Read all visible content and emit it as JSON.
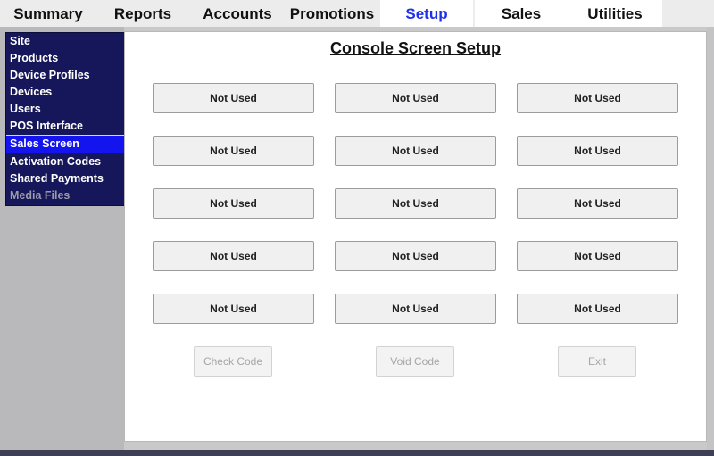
{
  "top_menu": [
    {
      "label": "Summary"
    },
    {
      "label": "Reports"
    },
    {
      "label": "Accounts"
    },
    {
      "label": "Promotions"
    },
    {
      "label": "Setup"
    },
    {
      "label": "Sales"
    },
    {
      "label": "Utilities"
    }
  ],
  "top_menu_active": "Setup",
  "sidebar": {
    "items": [
      {
        "label": "Site"
      },
      {
        "label": "Products"
      },
      {
        "label": "Device Profiles"
      },
      {
        "label": "Devices"
      },
      {
        "label": "Users"
      },
      {
        "label": "POS Interface"
      },
      {
        "label": "Sales Screen"
      },
      {
        "label": "Activation Codes"
      },
      {
        "label": "Shared Payments"
      },
      {
        "label": "Media Files"
      }
    ],
    "selected": "Sales Screen",
    "disabled": "Media Files"
  },
  "main": {
    "title": "Console Screen Setup",
    "slots": [
      [
        "Not Used",
        "Not Used",
        "Not Used"
      ],
      [
        "Not Used",
        "Not Used",
        "Not Used"
      ],
      [
        "Not Used",
        "Not Used",
        "Not Used"
      ],
      [
        "Not Used",
        "Not Used",
        "Not Used"
      ],
      [
        "Not Used",
        "Not Used",
        "Not Used"
      ]
    ],
    "actions": {
      "check_code": "Check Code",
      "void_code": "Void Code",
      "exit": "Exit"
    }
  },
  "colors": {
    "nav_bg": "#16175a",
    "nav_selected": "#1414ee",
    "active_tab_text": "#1f31e8"
  }
}
